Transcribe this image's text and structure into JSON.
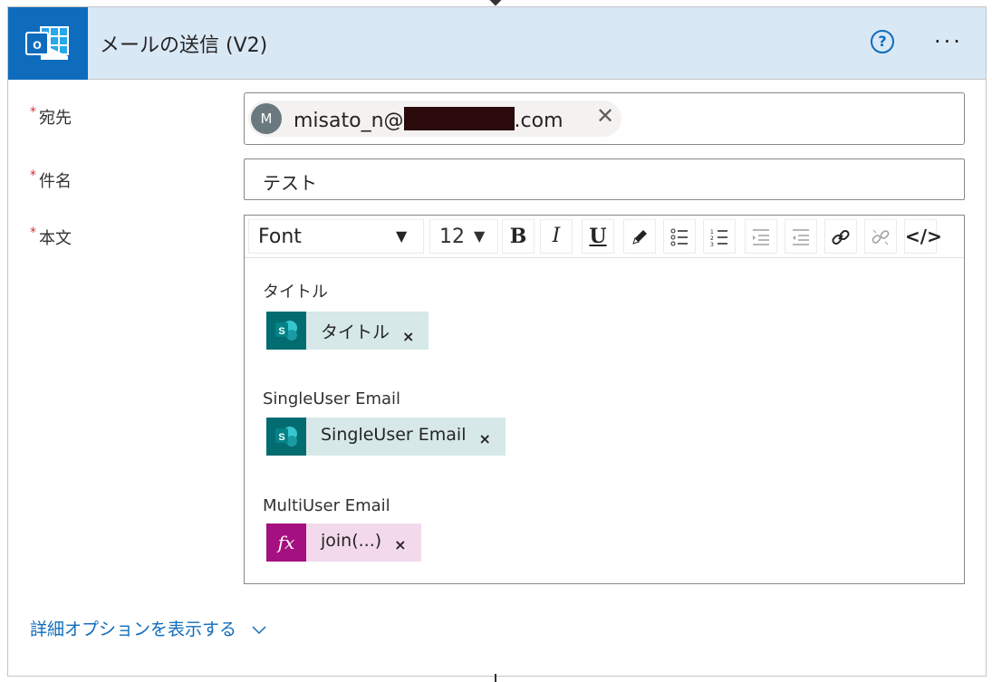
{
  "header": {
    "title": "メールの送信 (V2)",
    "app_icon": "outlook-icon",
    "help_symbol": "?",
    "more_symbol": "···"
  },
  "fields": {
    "to": {
      "label": "宛先",
      "required_mark": "*",
      "token_avatar": "M",
      "token_prefix": "misato_n@",
      "token_suffix": ".com",
      "token_close": "✕"
    },
    "subject": {
      "label": "件名",
      "required_mark": "*",
      "value": "テスト"
    },
    "body": {
      "label": "本文",
      "required_mark": "*",
      "toolbar": {
        "font_label": "Font",
        "size_label": "12",
        "bold": "B",
        "italic": "I",
        "underline": "U"
      },
      "content": [
        {
          "text": "タイトル",
          "token_label": "タイトル",
          "token_type": "sharepoint-icon",
          "token_color": "#d6e8e8",
          "icon_color": "#036c70"
        },
        {
          "text": "SingleUser Email",
          "token_label": "SingleUser Email",
          "token_type": "sharepoint-icon",
          "token_color": "#d6e8e8",
          "icon_color": "#036c70"
        },
        {
          "text": "MultiUser Email",
          "token_label": "join(...)",
          "token_type": "function-icon",
          "token_color": "#f2d9ec",
          "icon_color": "#a4107f"
        }
      ],
      "token_remove": "×"
    }
  },
  "advanced_options": {
    "label": "詳細オプションを表示する"
  }
}
